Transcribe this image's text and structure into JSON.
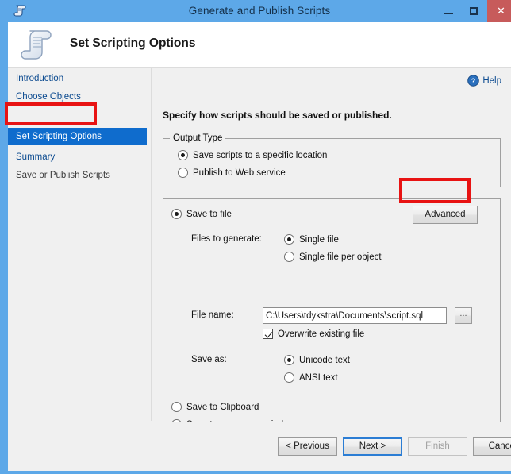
{
  "window": {
    "title": "Generate and Publish Scripts",
    "icon": "script-scroll-icon",
    "minimize_label": "–",
    "maximize_label": "□",
    "close_label": "✕"
  },
  "banner": {
    "title": "Set Scripting Options",
    "icon": "scroll-document-icon"
  },
  "sidebar": {
    "items": [
      {
        "label": "Introduction",
        "state": "done"
      },
      {
        "label": "Choose Objects",
        "state": "done"
      },
      {
        "label": "Set Scripting Options",
        "state": "selected"
      },
      {
        "label": "Summary",
        "state": "done"
      },
      {
        "label": "Save or Publish Scripts",
        "state": "future"
      }
    ]
  },
  "content": {
    "help_label": "Help",
    "help_icon": "help-question-icon",
    "instruction": "Specify how scripts should be saved or published.",
    "output_type": {
      "group_label": "Output Type",
      "options": [
        {
          "label": "Save scripts to a specific location",
          "checked": true
        },
        {
          "label": "Publish to Web service",
          "checked": false
        }
      ]
    },
    "save_to_file": {
      "radio_label": "Save to file",
      "radio_checked": true,
      "advanced_button": "Advanced",
      "files_to_generate_label": "Files to generate:",
      "files_to_generate_options": [
        {
          "label": "Single file",
          "checked": true
        },
        {
          "label": "Single file per object",
          "checked": false
        }
      ],
      "file_name_label": "File name:",
      "file_name_value": "C:\\Users\\tdykstra\\Documents\\script.sql",
      "browse_button": "...",
      "overwrite_label": "Overwrite existing file",
      "overwrite_checked": true,
      "save_as_label": "Save as:",
      "save_as_options": [
        {
          "label": "Unicode text",
          "checked": true
        },
        {
          "label": "ANSI text",
          "checked": false
        }
      ]
    },
    "other_outputs": [
      {
        "label": "Save to Clipboard",
        "checked": false
      },
      {
        "label": "Save to new query window",
        "checked": false
      }
    ]
  },
  "footer": {
    "previous_label": "< Previous",
    "next_label": "Next >",
    "finish_label": "Finish",
    "cancel_label": "Cancel"
  },
  "annotations": {
    "accent_color": "#e81313",
    "highlight_color": "#0f6ccd",
    "titlebar_color": "#5da8e8",
    "close_color": "#c75b5b"
  }
}
